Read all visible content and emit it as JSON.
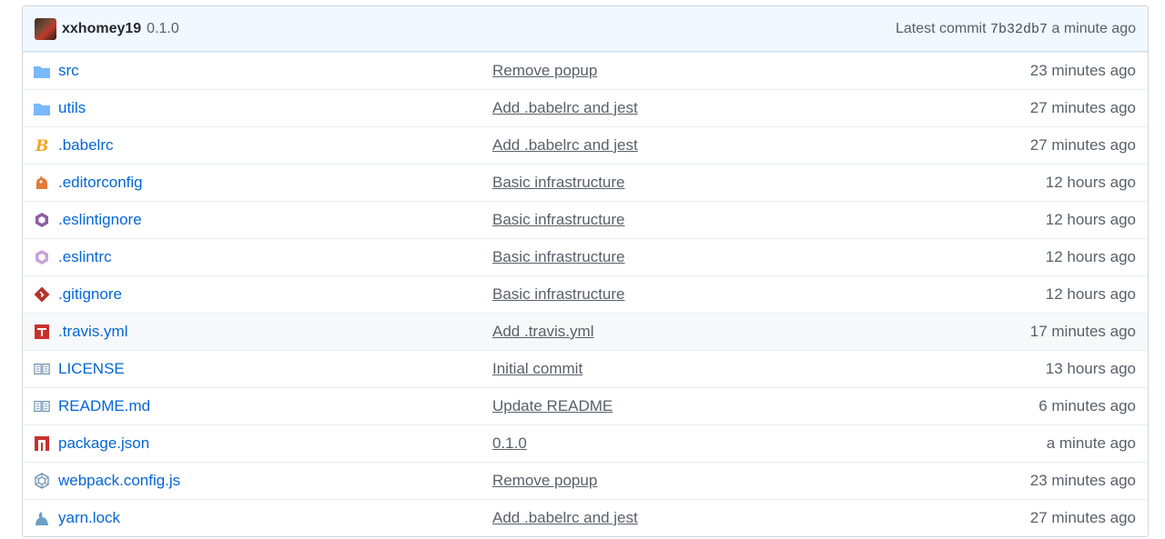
{
  "commit": {
    "author": "xxhomey19",
    "version": "0.1.0",
    "latest_label": "Latest commit",
    "sha": "7b32db7",
    "time": "a minute ago"
  },
  "files": [
    {
      "name": "src",
      "icon": "folder-icon",
      "message": "Remove popup",
      "age": "23 minutes ago"
    },
    {
      "name": "utils",
      "icon": "folder-icon",
      "message": "Add .babelrc and jest",
      "age": "27 minutes ago"
    },
    {
      "name": ".babelrc",
      "icon": "babel-icon",
      "message": "Add .babelrc and jest",
      "age": "27 minutes ago"
    },
    {
      "name": ".editorconfig",
      "icon": "editorconfig-icon",
      "message": "Basic infrastructure",
      "age": "12 hours ago"
    },
    {
      "name": ".eslintignore",
      "icon": "eslint-icon",
      "message": "Basic infrastructure",
      "age": "12 hours ago"
    },
    {
      "name": ".eslintrc",
      "icon": "eslint-light-icon",
      "message": "Basic infrastructure",
      "age": "12 hours ago"
    },
    {
      "name": ".gitignore",
      "icon": "git-icon",
      "message": "Basic infrastructure",
      "age": "12 hours ago"
    },
    {
      "name": ".travis.yml",
      "icon": "travis-icon",
      "message": "Add .travis.yml",
      "age": "17 minutes ago"
    },
    {
      "name": "LICENSE",
      "icon": "book-icon",
      "message": "Initial commit",
      "age": "13 hours ago"
    },
    {
      "name": "README.md",
      "icon": "book-icon",
      "message": "Update README",
      "age": "6 minutes ago"
    },
    {
      "name": "package.json",
      "icon": "npm-icon",
      "message": "0.1.0",
      "age": "a minute ago"
    },
    {
      "name": "webpack.config.js",
      "icon": "webpack-icon",
      "message": "Remove popup",
      "age": "23 minutes ago"
    },
    {
      "name": "yarn.lock",
      "icon": "yarn-icon",
      "message": "Add .babelrc and jest",
      "age": "27 minutes ago"
    }
  ],
  "colors": {
    "link": "#0366d6",
    "header_bg": "#f1f8ff",
    "folder": "#79b8ff"
  }
}
